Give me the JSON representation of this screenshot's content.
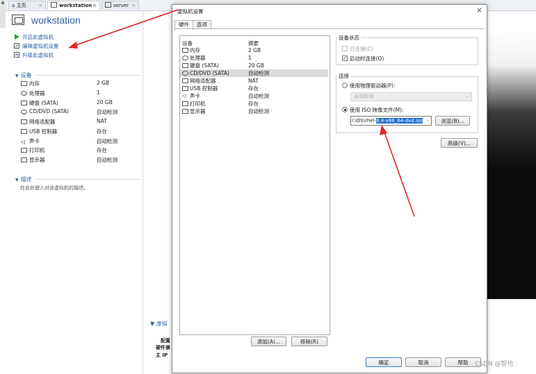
{
  "tabs": [
    {
      "label": "主页",
      "active": false
    },
    {
      "label": "workstation",
      "active": true
    },
    {
      "label": "server",
      "active": false
    }
  ],
  "left_panel": {
    "scroll_up_glyph": "▲",
    "vm_title": "workstation",
    "actions": [
      {
        "label": "开启此虚拟机",
        "icon": "play-icon"
      },
      {
        "label": "编辑虚拟机设置",
        "icon": "edit-settings-icon"
      },
      {
        "label": "升级此虚拟机",
        "icon": "upgrade-icon"
      }
    ],
    "devices_header": "设备",
    "devices": [
      {
        "name": "内存",
        "value": "2 GB",
        "icon": "memory-icon"
      },
      {
        "name": "处理器",
        "value": "1",
        "icon": "processor-icon"
      },
      {
        "name": "硬盘 (SATA)",
        "value": "20 GB",
        "icon": "harddisk-icon"
      },
      {
        "name": "CD/DVD (SATA)",
        "value": "自动检测",
        "icon": "cd-dvd-icon"
      },
      {
        "name": "网络适配器",
        "value": "NAT",
        "icon": "network-icon"
      },
      {
        "name": "USB 控制器",
        "value": "存在",
        "icon": "usb-icon"
      },
      {
        "name": "声卡",
        "value": "自动检测",
        "icon": "sound-icon"
      },
      {
        "name": "打印机",
        "value": "存在",
        "icon": "printer-icon"
      },
      {
        "name": "显示器",
        "value": "自动检测",
        "icon": "display-icon"
      }
    ],
    "description_header": "描述",
    "description_placeholder": "在此处键入对该虚拟机的描述。"
  },
  "vm_details": {
    "header": "虚拟",
    "lines": [
      "配置",
      "硬件兼",
      "主 IP"
    ]
  },
  "dialog": {
    "title": "虚拟机设置",
    "close_glyph": "×",
    "tabs": [
      "硬件",
      "选项"
    ],
    "list_headers": {
      "device": "设备",
      "summary": "摘要"
    },
    "devices": [
      {
        "name": "内存",
        "summary": "2 GB",
        "icon": "memory-icon",
        "selected": false
      },
      {
        "name": "处理器",
        "summary": "1",
        "icon": "processor-icon",
        "selected": false
      },
      {
        "name": "硬盘 (SATA)",
        "summary": "20 GB",
        "icon": "harddisk-icon",
        "selected": false
      },
      {
        "name": "CD/DVD (SATA)",
        "summary": "自动检测",
        "icon": "cd-dvd-icon",
        "selected": true
      },
      {
        "name": "网络适配器",
        "summary": "NAT",
        "icon": "network-icon",
        "selected": false
      },
      {
        "name": "USB 控制器",
        "summary": "存在",
        "icon": "usb-icon",
        "selected": false
      },
      {
        "name": "声卡",
        "summary": "自动检测",
        "icon": "sound-icon",
        "selected": false
      },
      {
        "name": "打印机",
        "summary": "存在",
        "icon": "printer-icon",
        "selected": false
      },
      {
        "name": "显示器",
        "summary": "自动检测",
        "icon": "display-icon",
        "selected": false
      }
    ],
    "add_button": "添加(A)...",
    "remove_button": "移除(R)",
    "device_status": {
      "title": "设备状态",
      "connected": {
        "label": "已连接(C)",
        "checked": false,
        "enabled": false
      },
      "connect_on_power": {
        "label": "启动时连接(O)",
        "checked": true,
        "enabled": true
      }
    },
    "connection": {
      "title": "连接",
      "use_physical": {
        "label": "使用物理驱动器(P):",
        "selected": false
      },
      "physical_value": "自动检测",
      "use_iso": {
        "label": "使用 ISO 映像文件(M):",
        "selected": true
      },
      "iso_prefix": "I:\\OS\\rhel-",
      "iso_selected": "8.4-x86_64-dvd.iso",
      "browse_button": "浏览(B)..."
    },
    "advanced_button": "高级(V)...",
    "ok_button": "确定",
    "cancel_button": "取消",
    "help_button": "帮助"
  },
  "watermark": "CSDN @智也",
  "colors": {
    "accent": "#2d5fa0",
    "arrow": "#e02424",
    "selection": "#1e6fd1"
  }
}
